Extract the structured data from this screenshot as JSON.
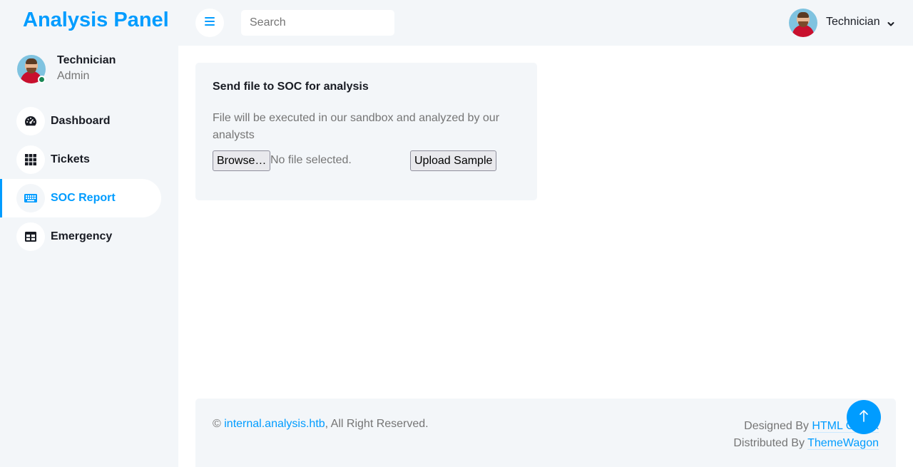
{
  "brand": "Analysis Panel",
  "user": {
    "name": "Technician",
    "role": "Admin"
  },
  "nav": [
    {
      "label": "Dashboard",
      "icon": "tachometer-icon"
    },
    {
      "label": "Tickets",
      "icon": "grid-icon"
    },
    {
      "label": "SOC Report",
      "icon": "keyboard-icon",
      "active": true
    },
    {
      "label": "Emergency",
      "icon": "table-icon"
    }
  ],
  "topbar": {
    "search_placeholder": "Search",
    "profile_name": "Technician"
  },
  "card": {
    "title": "Send file to SOC for analysis",
    "description": "File will be executed in our sandbox and analyzed by our analysts",
    "browse_label": "Browse…",
    "file_status": "No file selected.",
    "upload_label": "Upload Sample"
  },
  "footer": {
    "copyright_symbol": "©",
    "site_link": "internal.analysis.htb",
    "rights": ", All Right Reserved.",
    "designed_by": "Designed By",
    "designed_link": "HTML Codex",
    "distributed_by": "Distributed By",
    "distributed_link": "ThemeWagon"
  },
  "colors": {
    "accent": "#009cff",
    "panel": "#f3f6f9",
    "text_dark": "#191c24",
    "text_muted": "#757575",
    "online": "#198754"
  }
}
